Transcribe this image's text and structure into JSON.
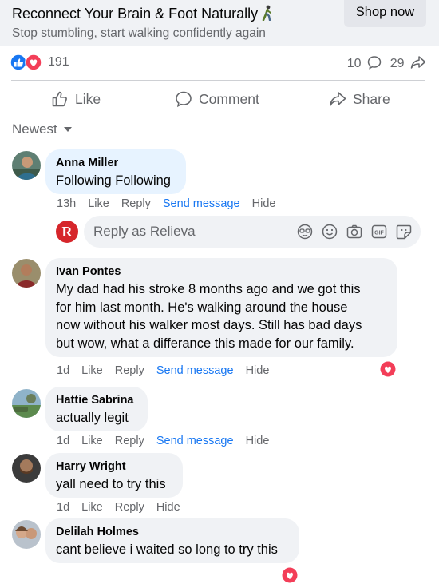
{
  "ad": {
    "title": "Reconnect Your Brain & Foot Naturally",
    "subtitle": "Stop stumbling, start walking confidently again",
    "cta": "Shop now"
  },
  "stats": {
    "reactions": "191",
    "comments": "10",
    "shares": "29"
  },
  "actions": {
    "like": "Like",
    "comment": "Comment",
    "share": "Share"
  },
  "sort": {
    "label": "Newest"
  },
  "reply": {
    "placeholder": "Reply as Relieva",
    "page_initial": "R"
  },
  "comments": [
    {
      "author": "Anna Miller",
      "text": "Following Following",
      "time": "13h",
      "like": "Like",
      "reply": "Reply",
      "send": "Send message",
      "hide": "Hide"
    },
    {
      "author": "Ivan Pontes",
      "lines": [
        "My dad had his stroke 8 months ago and we got this",
        "for him last month. He's walking around the house",
        "now without his walker most days. Still has bad days",
        "but wow, what a differance this made for our family."
      ],
      "time": "1d",
      "like": "Like",
      "reply": "Reply",
      "send": "Send message",
      "hide": "Hide"
    },
    {
      "author": "Hattie Sabrina",
      "text": "actually legit",
      "time": "1d",
      "like": "Like",
      "reply": "Reply",
      "send": "Send message",
      "hide": "Hide"
    },
    {
      "author": "Harry Wright",
      "text": "yall need to try this",
      "time": "1d",
      "like": "Like",
      "reply": "Reply",
      "hide": "Hide"
    },
    {
      "author": "Delilah Holmes",
      "text": "cant believe i waited so long to try this"
    }
  ],
  "colors": {
    "link": "#1877f2",
    "secondary": "#65676b",
    "bubble": "#f0f2f5",
    "bubble_highlight": "#e7f3ff",
    "love": "#f33e58"
  }
}
